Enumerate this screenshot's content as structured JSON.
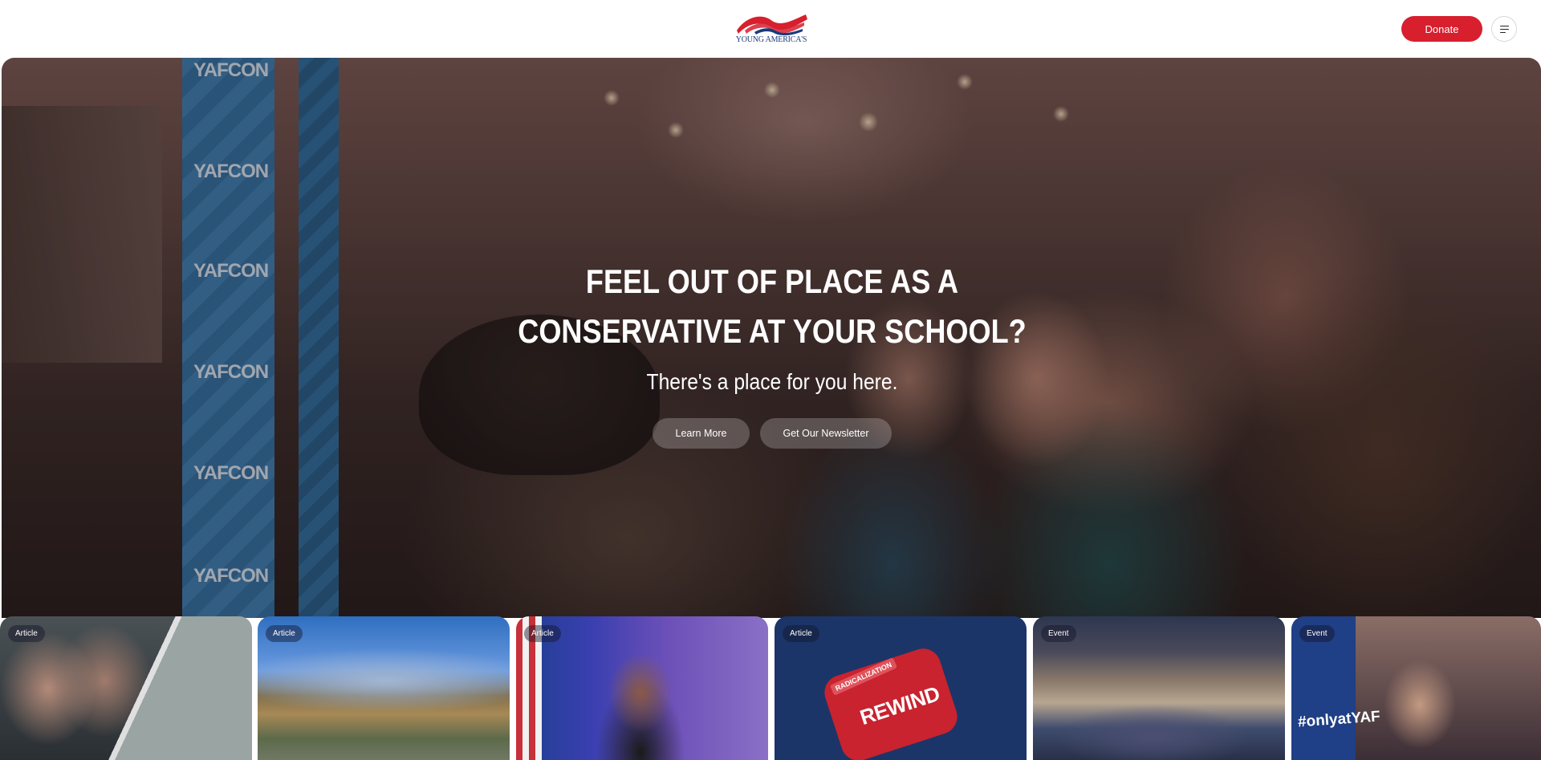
{
  "header": {
    "logo_text": "YOUNG AMERICA'S",
    "donate_label": "Donate"
  },
  "hero": {
    "title_line1": "FEEL OUT OF PLACE AS A",
    "title_line2": "CONSERVATIVE AT YOUR SCHOOL?",
    "subtitle": "There's a place for you here.",
    "learn_more_label": "Learn More",
    "newsletter_label": "Get Our Newsletter",
    "banner_word": "YAFCON"
  },
  "cards": [
    {
      "tag": "Article"
    },
    {
      "tag": "Article"
    },
    {
      "tag": "Article"
    },
    {
      "tag": "Article",
      "image_text_1": "RADICALIZATION",
      "image_text_2": "REWIND"
    },
    {
      "tag": "Event"
    },
    {
      "tag": "Event",
      "image_text": "#onlyatYAF"
    }
  ],
  "colors": {
    "accent": "#d71f2e",
    "brand_navy": "#1b3a7a"
  }
}
